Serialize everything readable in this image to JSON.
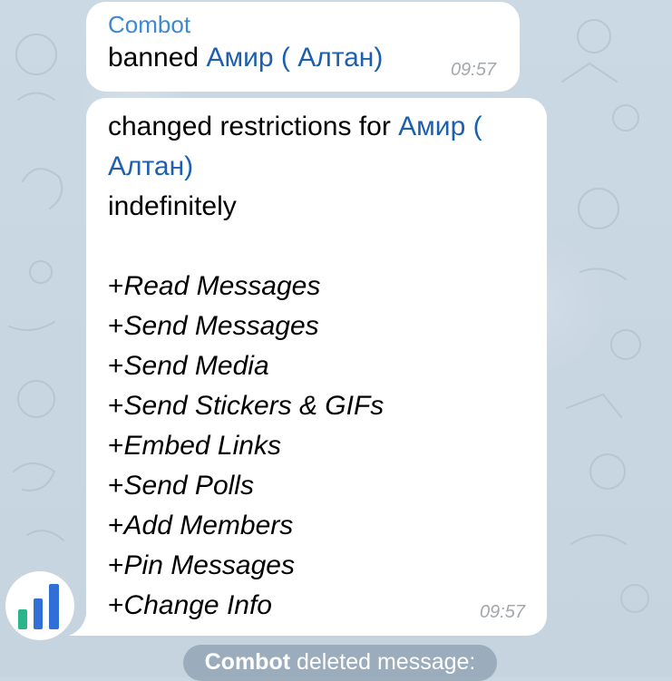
{
  "messages": [
    {
      "sender": "Combot",
      "text": "banned",
      "mention": "Амир ( Алтан)",
      "time": "09:57"
    },
    {
      "text": "changed restrictions for",
      "mention": "Амир ( Алтан)",
      "duration": "indefinitely",
      "permissions": [
        "Read Messages",
        "Send Messages",
        "Send Media",
        "Send Stickers & GIFs",
        "Embed Links",
        "Send Polls",
        "Add Members",
        "Pin Messages",
        "Change Info"
      ],
      "time": "09:57"
    }
  ],
  "service_message": {
    "actor": "Combot",
    "text": "deleted message:"
  },
  "avatar": {
    "icon": "bar-chart-icon",
    "colors": [
      "#2bb58a",
      "#2f6fd6",
      "#2f6fd6"
    ]
  },
  "colors": {
    "sender": "#3a8ad4",
    "mention": "#1c5fae",
    "time": "#a3a8ad",
    "bubble": "#ffffff",
    "wallpaper": "#c9d7e2"
  }
}
